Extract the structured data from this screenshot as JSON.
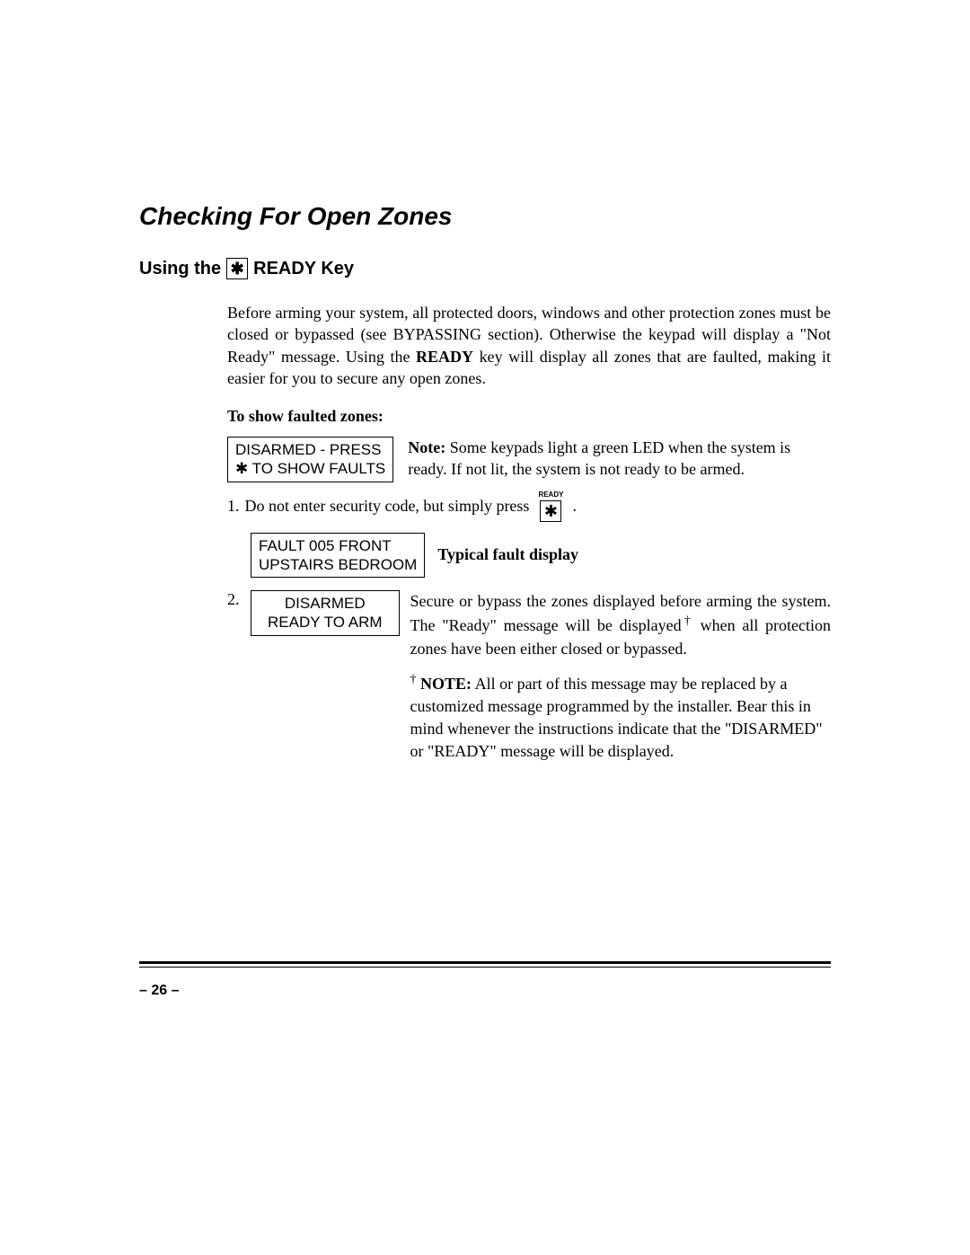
{
  "title": "Checking For Open Zones",
  "subtitle_prefix": "Using the",
  "subtitle_suffix": "READY Key",
  "star": "✱",
  "intro": "Before arming your system, all protected doors, windows and other protection zones must be closed or bypassed (see BYPASSING section). Otherwise the keypad will display a \"Not Ready\" message. Using the ",
  "intro_ready": "READY",
  "intro_tail": " key will display all zones that are faulted, making it easier for you to secure any open zones.",
  "subhead": "To show faulted zones:",
  "display_disarmed_press": "DISARMED - PRESS",
  "display_show_faults": "✱ TO SHOW FAULTS",
  "note_prefix": "Note:",
  "note_text": " Some keypads light a green LED when the system is ready. If not lit, the system is not ready to be armed.",
  "step1_num": "1.",
  "step1_text": "Do not enter security code, but simply press",
  "step1_period": ".",
  "key_label_ready": "READY",
  "fault_line1": "FAULT  005  FRONT",
  "fault_line2": "UPSTAIRS BEDROOM",
  "fault_caption": "Typical fault display",
  "step2_num": "2.",
  "display_disarmed": "DISARMED",
  "display_ready_arm": "READY TO ARM",
  "step2_text_a": "Secure or bypass the zones displayed before arming the system. The \"Ready\" message will be displayed",
  "step2_text_b": " when all protection zones have been either closed or bypassed.",
  "dagger": "†",
  "note2_prefix": "NOTE:",
  "note2_text": " All or part of this message may be replaced by a customized message programmed by the installer. Bear this in mind whenever the instructions indicate that the \"DISARMED\" or \"READY\" message will be displayed.",
  "page_num": "– 26 –"
}
